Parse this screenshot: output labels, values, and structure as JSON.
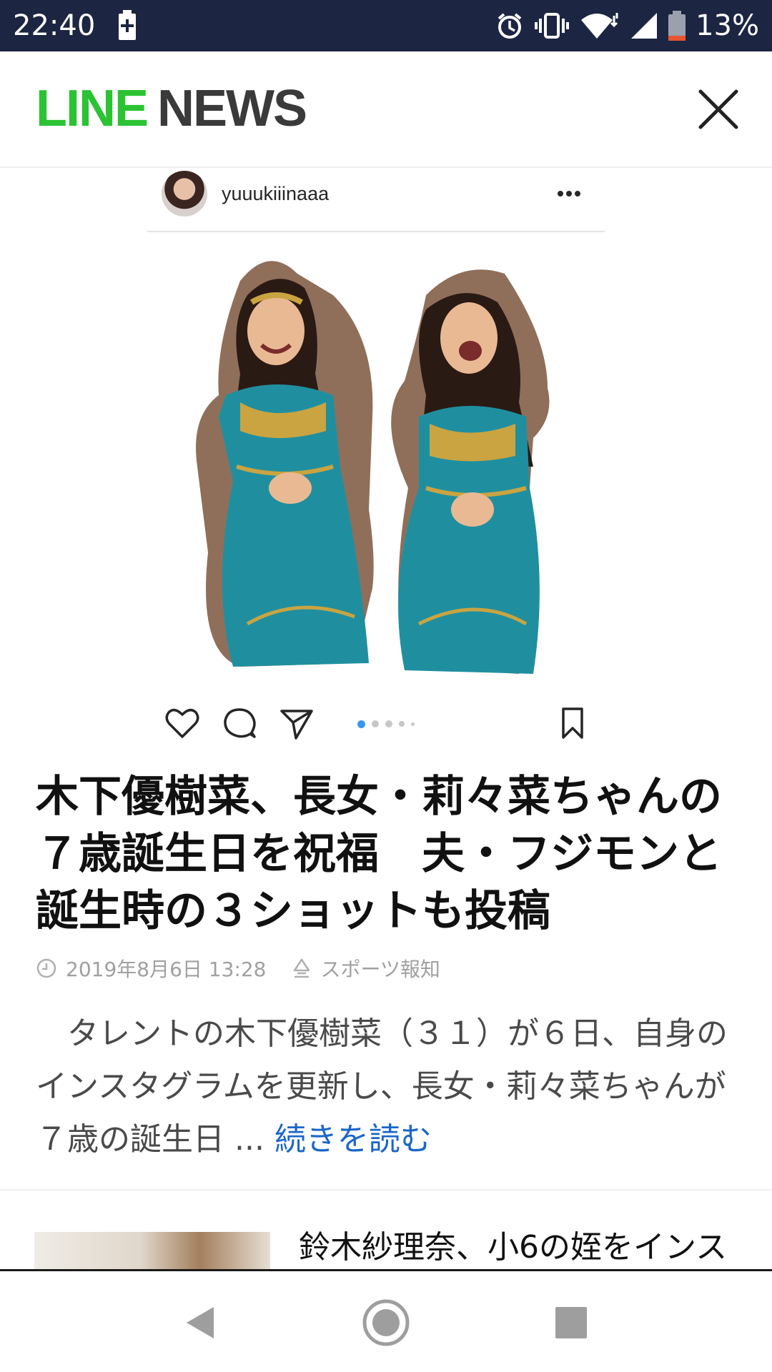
{
  "status_bar": {
    "time": "22:40",
    "battery_percent": "13%",
    "icons": [
      "battery-charging-icon",
      "alarm-icon",
      "vibrate-icon",
      "wifi-icon",
      "signal-icon",
      "battery-icon"
    ]
  },
  "header": {
    "logo_line": "LINE",
    "logo_news": "NEWS",
    "close_icon": "close-icon",
    "brand_color": "#2bc334"
  },
  "embed": {
    "username": "yuuukiiinaaa",
    "more_icon": "more-icon",
    "actions": [
      "heart-icon",
      "comment-icon",
      "share-icon",
      "bookmark-icon"
    ],
    "carousel": {
      "count": 5,
      "active_index": 0
    },
    "photo_icon": "photo-two-girls-costume"
  },
  "article": {
    "title": "木下優樹菜、長女・莉々菜ちゃんの７歳誕生日を祝福　夫・フジモンと誕生時の３ショットも投稿",
    "date": "2019年8月6日 13:28",
    "source": "スポーツ報知",
    "summary": "　タレントの木下優樹菜（３１）が６日、自身のインスタグラムを更新し、長女・莉々菜ちゃんが７歳の誕生日 ... ",
    "read_more": "続きを読む",
    "link_color": "#1b66c9"
  },
  "related": {
    "title": "鈴木紗理奈、小6の姪をインス"
  },
  "nav_bar": {
    "buttons": [
      "back-icon",
      "home-icon",
      "recents-icon"
    ]
  }
}
